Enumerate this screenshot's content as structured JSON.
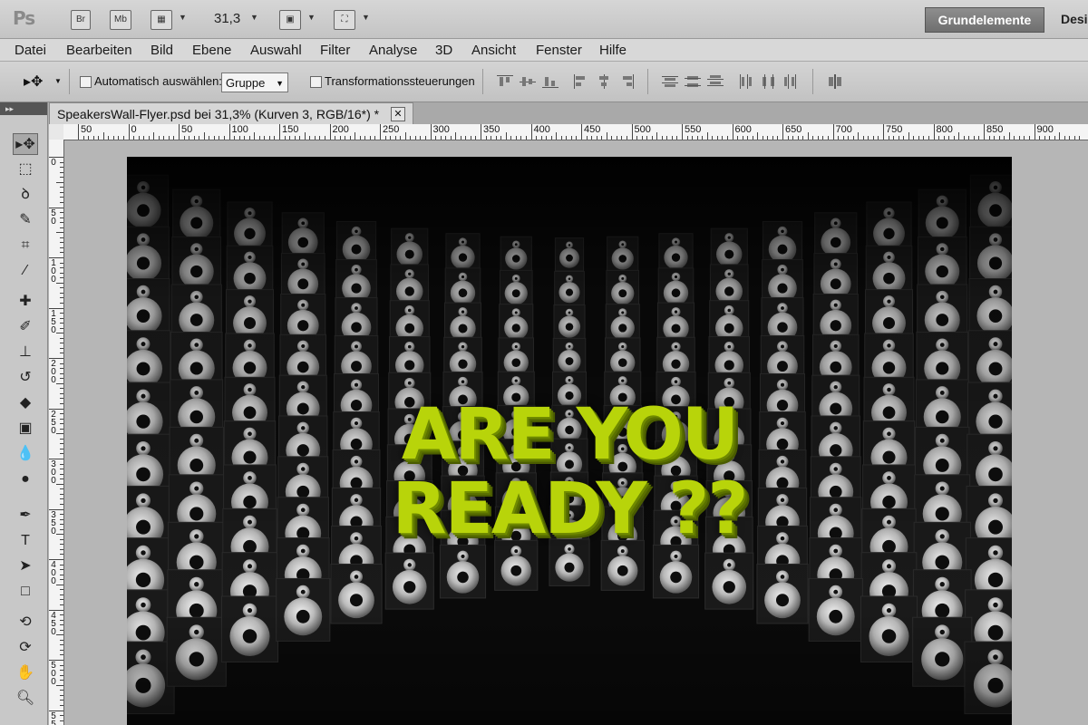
{
  "app": {
    "logo": "Ps",
    "bridge_label": "Br",
    "minibridge_label": "Mb",
    "zoom_value": "31,3",
    "workspace_active": "Grundelemente",
    "workspace_next": "Desi"
  },
  "menu": [
    "Datei",
    "Bearbeiten",
    "Bild",
    "Ebene",
    "Auswahl",
    "Filter",
    "Analyse",
    "3D",
    "Ansicht",
    "Fenster",
    "Hilfe"
  ],
  "options": {
    "auto_select_label": "Automatisch auswählen:",
    "auto_select_value": "Gruppe",
    "transform_label": "Transformationssteuerungen"
  },
  "document": {
    "tab_title": "SpeakersWall-Flyer.psd bei 31,3% (Kurven 3, RGB/16*) *",
    "close_label": "✕"
  },
  "ruler": {
    "h_labels": [
      "50",
      "0",
      "50",
      "100",
      "150",
      "200",
      "250",
      "300",
      "350",
      "400",
      "450",
      "500",
      "550",
      "600",
      "650",
      "700",
      "750",
      "800",
      "850",
      "900"
    ],
    "v_labels": [
      "0",
      "5\n0",
      "1\n0\n0",
      "1\n5\n0",
      "2\n0\n0",
      "2\n5\n0",
      "3\n0\n0",
      "3\n5\n0",
      "4\n0\n0",
      "4\n5\n0",
      "5\n0\n0",
      "5\n5\n0"
    ]
  },
  "artwork": {
    "line1": "ARE YOU",
    "line2": "READY ??",
    "text_color": "#b8d40a"
  },
  "tools": [
    "move-icon",
    "marquee-icon",
    "lasso-icon",
    "quick-select-icon",
    "crop-icon",
    "eyedropper-icon",
    "healing-brush-icon",
    "brush-icon",
    "clone-stamp-icon",
    "history-brush-icon",
    "eraser-icon",
    "gradient-icon",
    "blur-icon",
    "dodge-icon",
    "pen-icon",
    "type-icon",
    "path-select-icon",
    "rectangle-icon",
    "3d-rotate-icon",
    "3d-orbit-icon",
    "hand-icon",
    "zoom-icon"
  ]
}
